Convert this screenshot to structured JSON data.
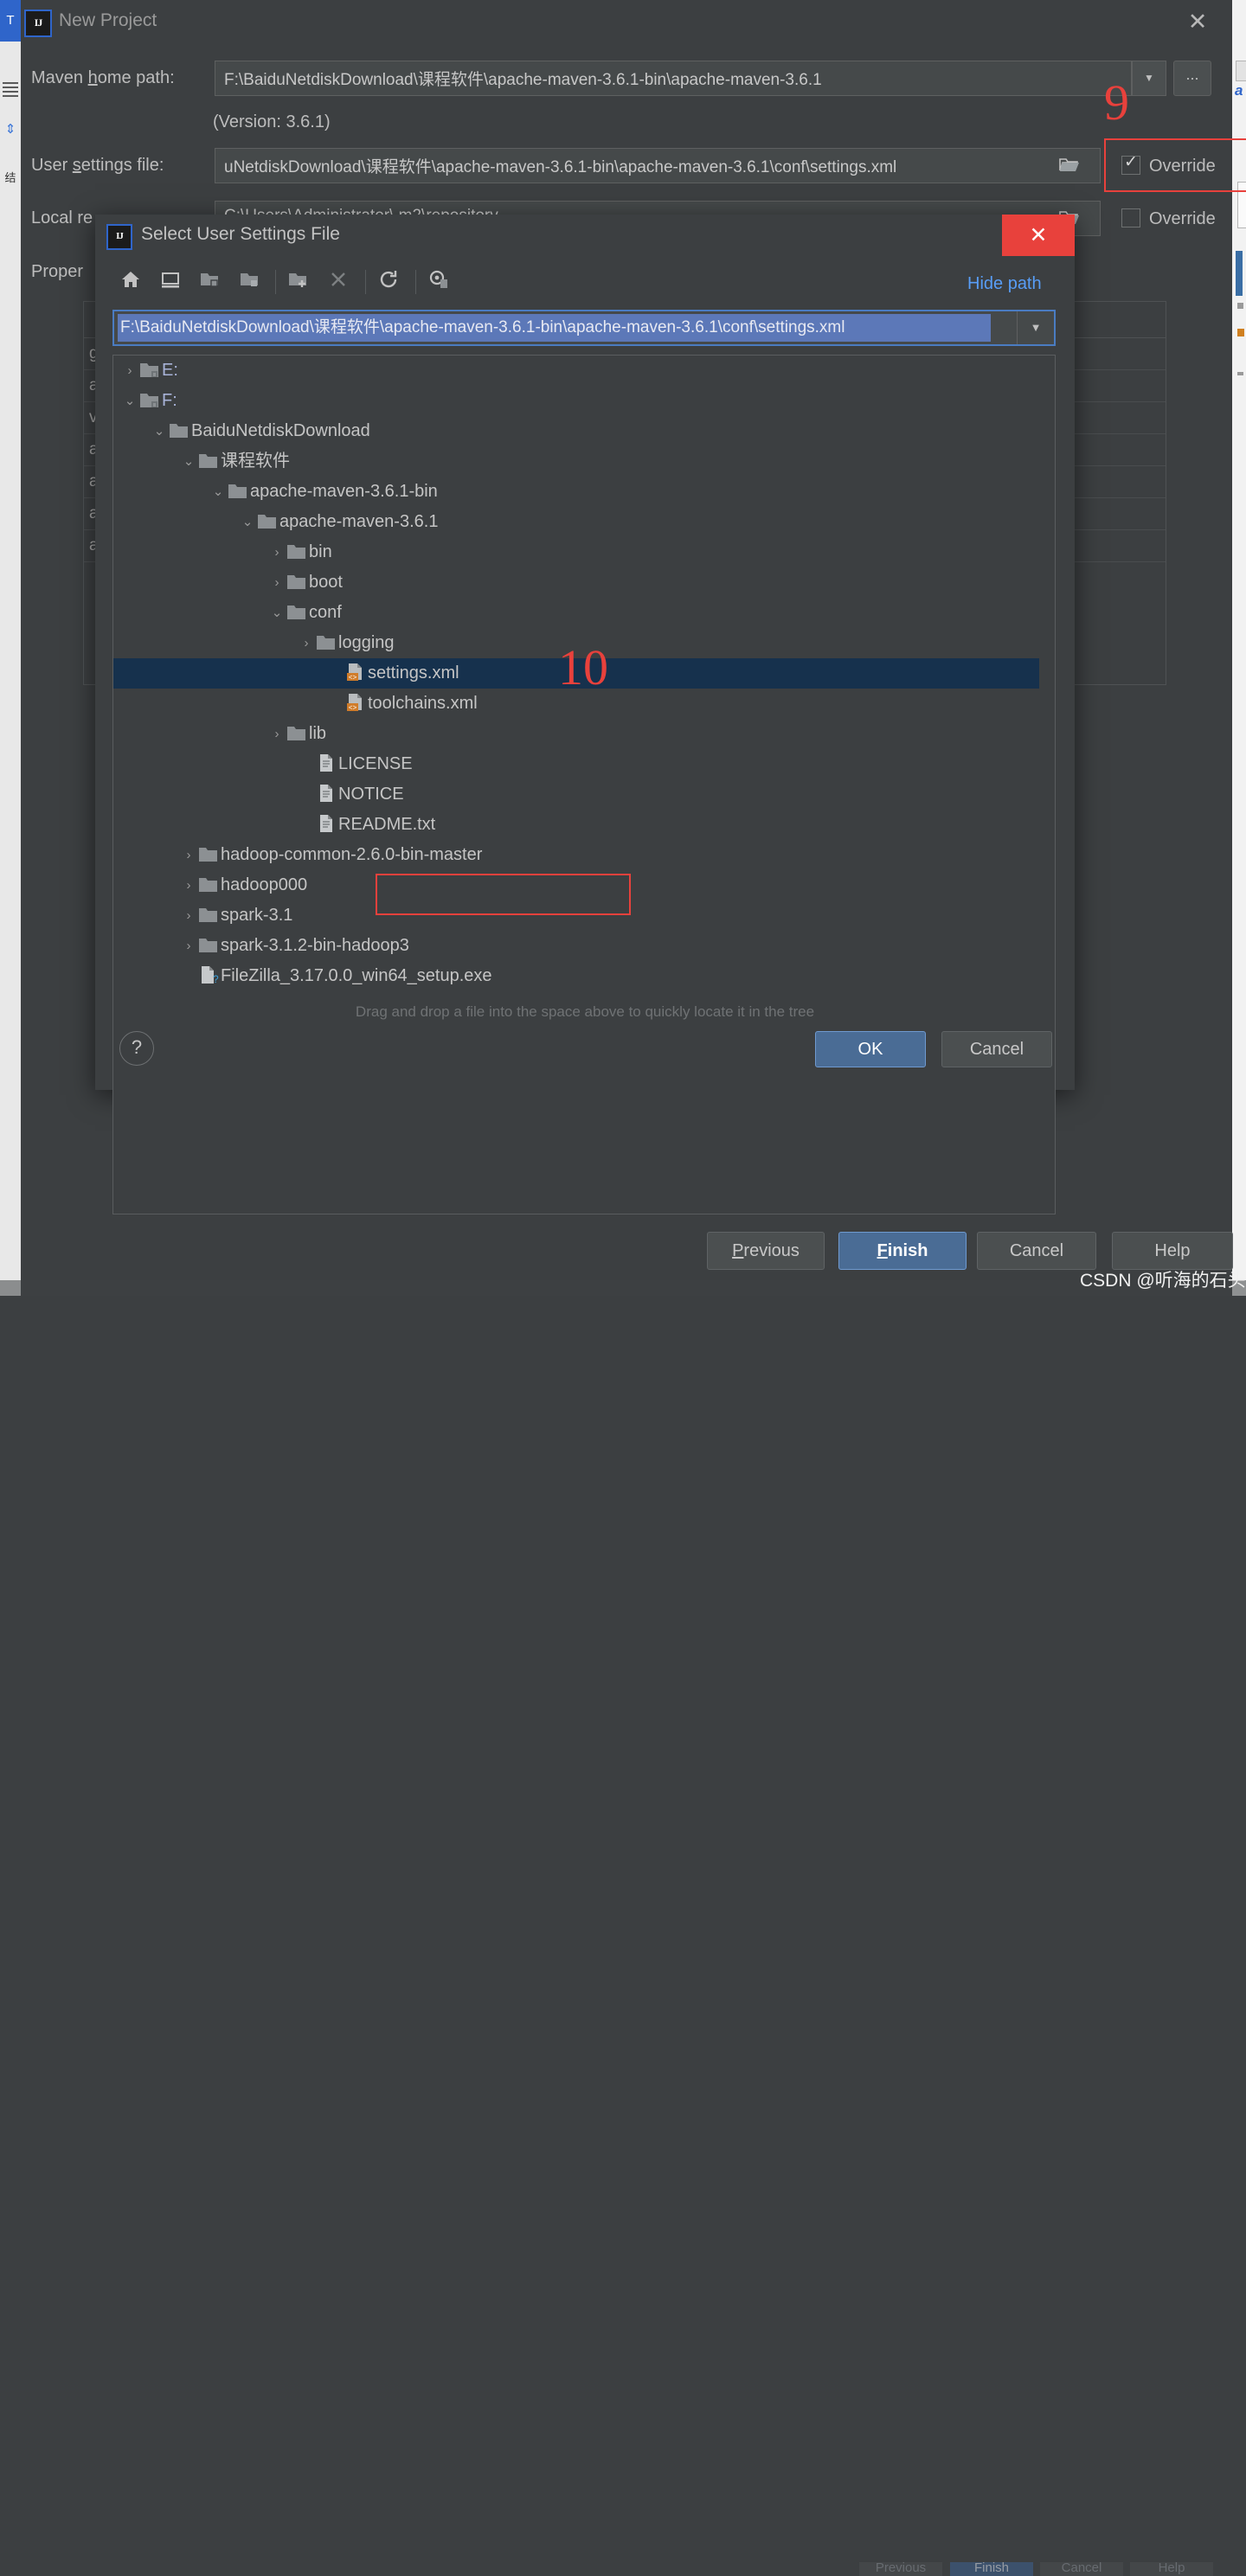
{
  "ide": {
    "left_tab_label": "T",
    "left_icon_names": [
      "lines-icon",
      "sort-arrows-icon",
      "cjk-glyph-icon"
    ],
    "right_glyph": "a"
  },
  "new_project": {
    "title": "New Project",
    "app_icon": "IJ",
    "close_label": "✕",
    "fields": {
      "maven_home_label_prefix": "Maven ",
      "maven_home_label_mnemonic": "h",
      "maven_home_label_suffix": "ome path:",
      "maven_home_value": "F:\\BaiduNetdiskDownload\\课程软件\\apache-maven-3.6.1-bin\\apache-maven-3.6.1",
      "maven_home_dropdown": "▼",
      "maven_browse_label": "...",
      "version_text": "(Version: 3.6.1)",
      "user_settings_label_prefix": "User ",
      "user_settings_label_mnemonic": "s",
      "user_settings_label_suffix": "ettings file:",
      "user_settings_value": "uNetdiskDownload\\课程软件\\apache-maven-3.6.1-bin\\apache-maven-3.6.1\\conf\\settings.xml",
      "local_repo_label": "Local re",
      "local_repo_value": "C:\\Users\\Administrator\\.m2\\repository",
      "properties_label": "Proper",
      "override_1_label": "Override",
      "override_1_checked": true,
      "override_2_label": "Override",
      "override_2_checked": false
    },
    "properties_table": {
      "add_button": "+",
      "rows": [
        "gro",
        "arti",
        "ver",
        "arc",
        "arc",
        "arc",
        "arc"
      ]
    },
    "wizard_buttons": {
      "previous_prefix": "",
      "previous_mnemonic": "P",
      "previous_suffix": "revious",
      "finish_mnemonic": "F",
      "finish_suffix": "inish",
      "cancel": "Cancel",
      "help": "Help"
    }
  },
  "file_dialog": {
    "title": "Select User Settings File",
    "app_icon": "IJ",
    "close_label": "✕",
    "toolbar": [
      {
        "name": "home-icon",
        "tip": "Home"
      },
      {
        "name": "desktop-icon",
        "tip": "Desktop"
      },
      {
        "name": "collapse-folder-icon",
        "tip": "Collapse"
      },
      {
        "name": "expand-folder-icon",
        "tip": "Expand"
      },
      {
        "name": "new-folder-icon",
        "tip": "New Folder"
      },
      {
        "name": "delete-icon",
        "tip": "Delete"
      },
      {
        "name": "refresh-icon",
        "tip": "Refresh"
      },
      {
        "name": "show-hidden-icon",
        "tip": "Show Hidden Files"
      }
    ],
    "hide_path_label": "Hide path",
    "path_value": "F:\\BaiduNetdiskDownload\\课程软件\\apache-maven-3.6.1-bin\\apache-maven-3.6.1\\conf\\settings.xml",
    "path_dropdown": "▼",
    "tree": [
      {
        "label": "E:",
        "indent": 0,
        "twisty": "›",
        "icon": "drive-folder-icon",
        "kind": "drive",
        "selected": false
      },
      {
        "label": "F:",
        "indent": 0,
        "twisty": "⌄",
        "icon": "drive-folder-icon",
        "kind": "drive",
        "selected": false
      },
      {
        "label": "BaiduNetdiskDownload",
        "indent": 1,
        "twisty": "⌄",
        "icon": "folder-icon",
        "kind": "folder",
        "selected": false
      },
      {
        "label": "课程软件",
        "indent": 2,
        "twisty": "⌄",
        "icon": "folder-icon",
        "kind": "folder",
        "selected": false
      },
      {
        "label": "apache-maven-3.6.1-bin",
        "indent": 3,
        "twisty": "⌄",
        "icon": "folder-icon",
        "kind": "folder",
        "selected": false
      },
      {
        "label": "apache-maven-3.6.1",
        "indent": 4,
        "twisty": "⌄",
        "icon": "folder-icon",
        "kind": "folder",
        "selected": false
      },
      {
        "label": "bin",
        "indent": 5,
        "twisty": "›",
        "icon": "folder-icon",
        "kind": "folder",
        "selected": false
      },
      {
        "label": "boot",
        "indent": 5,
        "twisty": "›",
        "icon": "folder-icon",
        "kind": "folder",
        "selected": false
      },
      {
        "label": "conf",
        "indent": 5,
        "twisty": "⌄",
        "icon": "folder-icon",
        "kind": "folder",
        "selected": false
      },
      {
        "label": "logging",
        "indent": 6,
        "twisty": "›",
        "icon": "folder-icon",
        "kind": "folder",
        "selected": false
      },
      {
        "label": "settings.xml",
        "indent": 7,
        "twisty": "",
        "icon": "xml-file-icon",
        "kind": "xml",
        "selected": true
      },
      {
        "label": "toolchains.xml",
        "indent": 7,
        "twisty": "",
        "icon": "xml-file-icon",
        "kind": "xml",
        "selected": false
      },
      {
        "label": "lib",
        "indent": 5,
        "twisty": "›",
        "icon": "folder-icon",
        "kind": "folder",
        "selected": false
      },
      {
        "label": "LICENSE",
        "indent": 6,
        "twisty": "",
        "icon": "text-file-icon",
        "kind": "file",
        "selected": false
      },
      {
        "label": "NOTICE",
        "indent": 6,
        "twisty": "",
        "icon": "text-file-icon",
        "kind": "file",
        "selected": false
      },
      {
        "label": "README.txt",
        "indent": 6,
        "twisty": "",
        "icon": "text-file-icon",
        "kind": "file",
        "selected": false
      },
      {
        "label": "hadoop-common-2.6.0-bin-master",
        "indent": 2,
        "twisty": "›",
        "icon": "folder-icon",
        "kind": "folder",
        "selected": false
      },
      {
        "label": "hadoop000",
        "indent": 2,
        "twisty": "›",
        "icon": "folder-icon",
        "kind": "folder",
        "selected": false
      },
      {
        "label": "spark-3.1",
        "indent": 2,
        "twisty": "›",
        "icon": "folder-icon",
        "kind": "folder",
        "selected": false
      },
      {
        "label": "spark-3.1.2-bin-hadoop3",
        "indent": 2,
        "twisty": "›",
        "icon": "folder-icon",
        "kind": "folder",
        "selected": false
      },
      {
        "label": "FileZilla_3.17.0.0_win64_setup.exe",
        "indent": 2,
        "twisty": "",
        "icon": "exe-file-icon",
        "kind": "exe",
        "selected": false
      }
    ],
    "hint_text": "Drag and drop a file into the space above to quickly locate it in the tree",
    "help_label": "?",
    "ok_label": "OK",
    "cancel_label": "Cancel"
  },
  "annotations": {
    "step_9": "9",
    "step_10": "10"
  },
  "watermark": "CSDN @听海的石头",
  "ghost_buttons": [
    "Previous",
    "Finish",
    "Cancel",
    "Help"
  ],
  "colors": {
    "window_bg": "#3c3f41",
    "field_bg": "#45494a",
    "accent_blue": "#4a6c95",
    "annotation_red": "#e8413c",
    "selection_navy": "#16314d",
    "path_selection": "#5c78b8",
    "link_blue": "#589df6"
  }
}
